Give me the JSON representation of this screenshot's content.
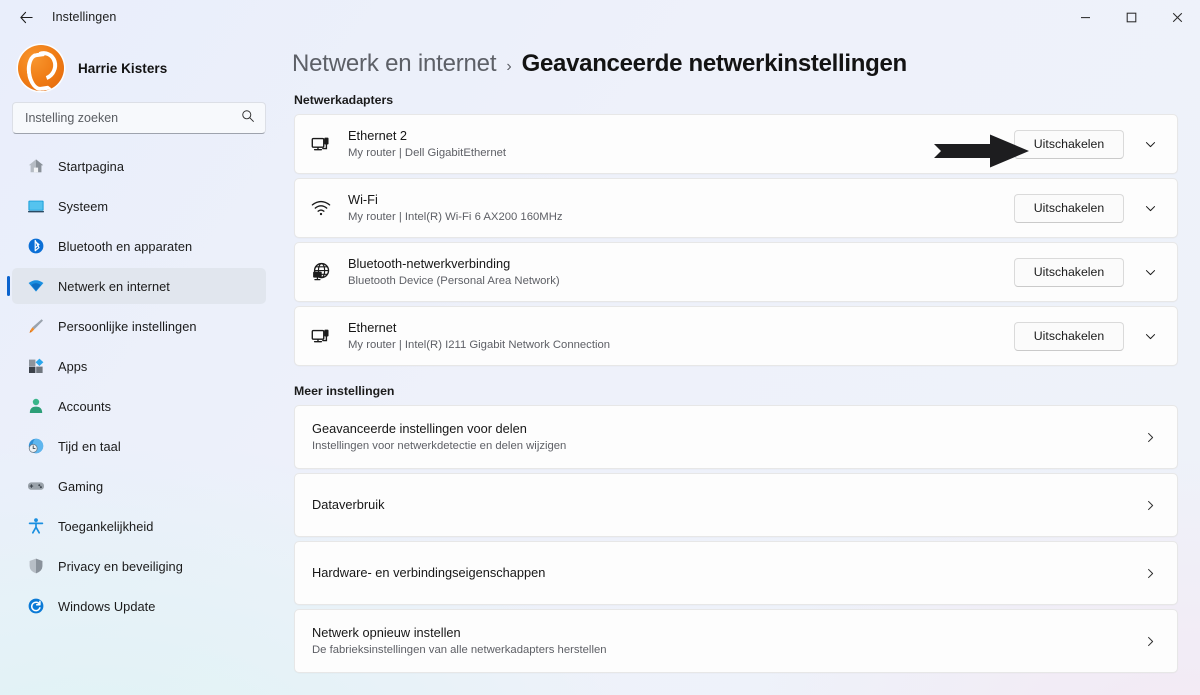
{
  "window": {
    "title": "Instellingen",
    "back_icon": "back-arrow-icon",
    "minimize_glyph": "–",
    "maximize_glyph": "☐",
    "close_glyph": "✕"
  },
  "sidebar": {
    "account_name": "Harrie Kisters",
    "avatar_icon": "user-avatar-logo",
    "search": {
      "placeholder": "Instelling zoeken",
      "value": "",
      "icon": "search-icon"
    },
    "items": [
      {
        "label": "Startpagina",
        "icon": "home-icon",
        "active": false
      },
      {
        "label": "Systeem",
        "icon": "display-icon",
        "active": false
      },
      {
        "label": "Bluetooth en apparaten",
        "icon": "bluetooth-icon",
        "active": false
      },
      {
        "label": "Netwerk en internet",
        "icon": "wifi-icon",
        "active": true
      },
      {
        "label": "Persoonlijke instellingen",
        "icon": "paintbrush-icon",
        "active": false
      },
      {
        "label": "Apps",
        "icon": "apps-icon",
        "active": false
      },
      {
        "label": "Accounts",
        "icon": "person-icon",
        "active": false
      },
      {
        "label": "Tijd en taal",
        "icon": "clock-globe-icon",
        "active": false
      },
      {
        "label": "Gaming",
        "icon": "gamepad-icon",
        "active": false
      },
      {
        "label": "Toegankelijkheid",
        "icon": "accessibility-icon",
        "active": false
      },
      {
        "label": "Privacy en beveiliging",
        "icon": "shield-icon",
        "active": false
      },
      {
        "label": "Windows Update",
        "icon": "update-icon",
        "active": false
      }
    ]
  },
  "breadcrumb": {
    "parent": "Netwerk en internet",
    "separator": "›",
    "current": "Geavanceerde netwerkinstellingen"
  },
  "adapters_section": {
    "heading": "Netwerkadapters",
    "items": [
      {
        "name": "Ethernet 2",
        "details": "My router | Dell GigabitEthernet",
        "icon": "ethernet-icon",
        "button_label": "Uitschakelen",
        "expand_icon": "chevron-down-icon",
        "annotated": true
      },
      {
        "name": "Wi-Fi",
        "details": "My router | Intel(R) Wi-Fi 6 AX200 160MHz",
        "icon": "wifi-icon",
        "button_label": "Uitschakelen",
        "expand_icon": "chevron-down-icon",
        "annotated": false
      },
      {
        "name": "Bluetooth-netwerkverbinding",
        "details": "Bluetooth Device (Personal Area Network)",
        "icon": "globe-network-icon",
        "button_label": "Uitschakelen",
        "expand_icon": "chevron-down-icon",
        "annotated": false
      },
      {
        "name": "Ethernet",
        "details": "My router | Intel(R) I211 Gigabit Network Connection",
        "icon": "ethernet-icon",
        "button_label": "Uitschakelen",
        "expand_icon": "chevron-down-icon",
        "annotated": false
      }
    ]
  },
  "more_section": {
    "heading": "Meer instellingen",
    "items": [
      {
        "title": "Geavanceerde instellingen voor delen",
        "subtitle": "Instellingen voor netwerkdetectie en delen wijzigen",
        "chevron_icon": "chevron-right-icon"
      },
      {
        "title": "Dataverbruik",
        "subtitle": "",
        "chevron_icon": "chevron-right-icon"
      },
      {
        "title": "Hardware- en verbindingseigenschappen",
        "subtitle": "",
        "chevron_icon": "chevron-right-icon"
      },
      {
        "title": "Netwerk opnieuw instellen",
        "subtitle": "De fabrieksinstellingen van alle netwerkadapters herstellen",
        "chevron_icon": "chevron-right-icon"
      }
    ]
  },
  "annotation": {
    "type": "arrow",
    "icon": "annotation-arrow-icon",
    "color": "#1d1d1f",
    "points_to": "Uitschakelen"
  },
  "colors": {
    "accent": "#0b63ce",
    "background": "#eef1fa",
    "card": "#fdfdfd",
    "selected_nav": "#e1e6ee",
    "avatar_orange": "#f07d16"
  }
}
